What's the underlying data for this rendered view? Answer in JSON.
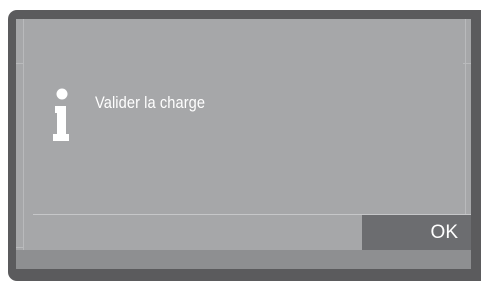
{
  "dialog": {
    "icon": "info-icon",
    "message": "Valider la charge",
    "ok_label": "OK"
  },
  "colors": {
    "bezel": "#5b5b5d",
    "screen": "#a6a7a9",
    "button": "#6c6d70",
    "text": "#ffffff"
  }
}
